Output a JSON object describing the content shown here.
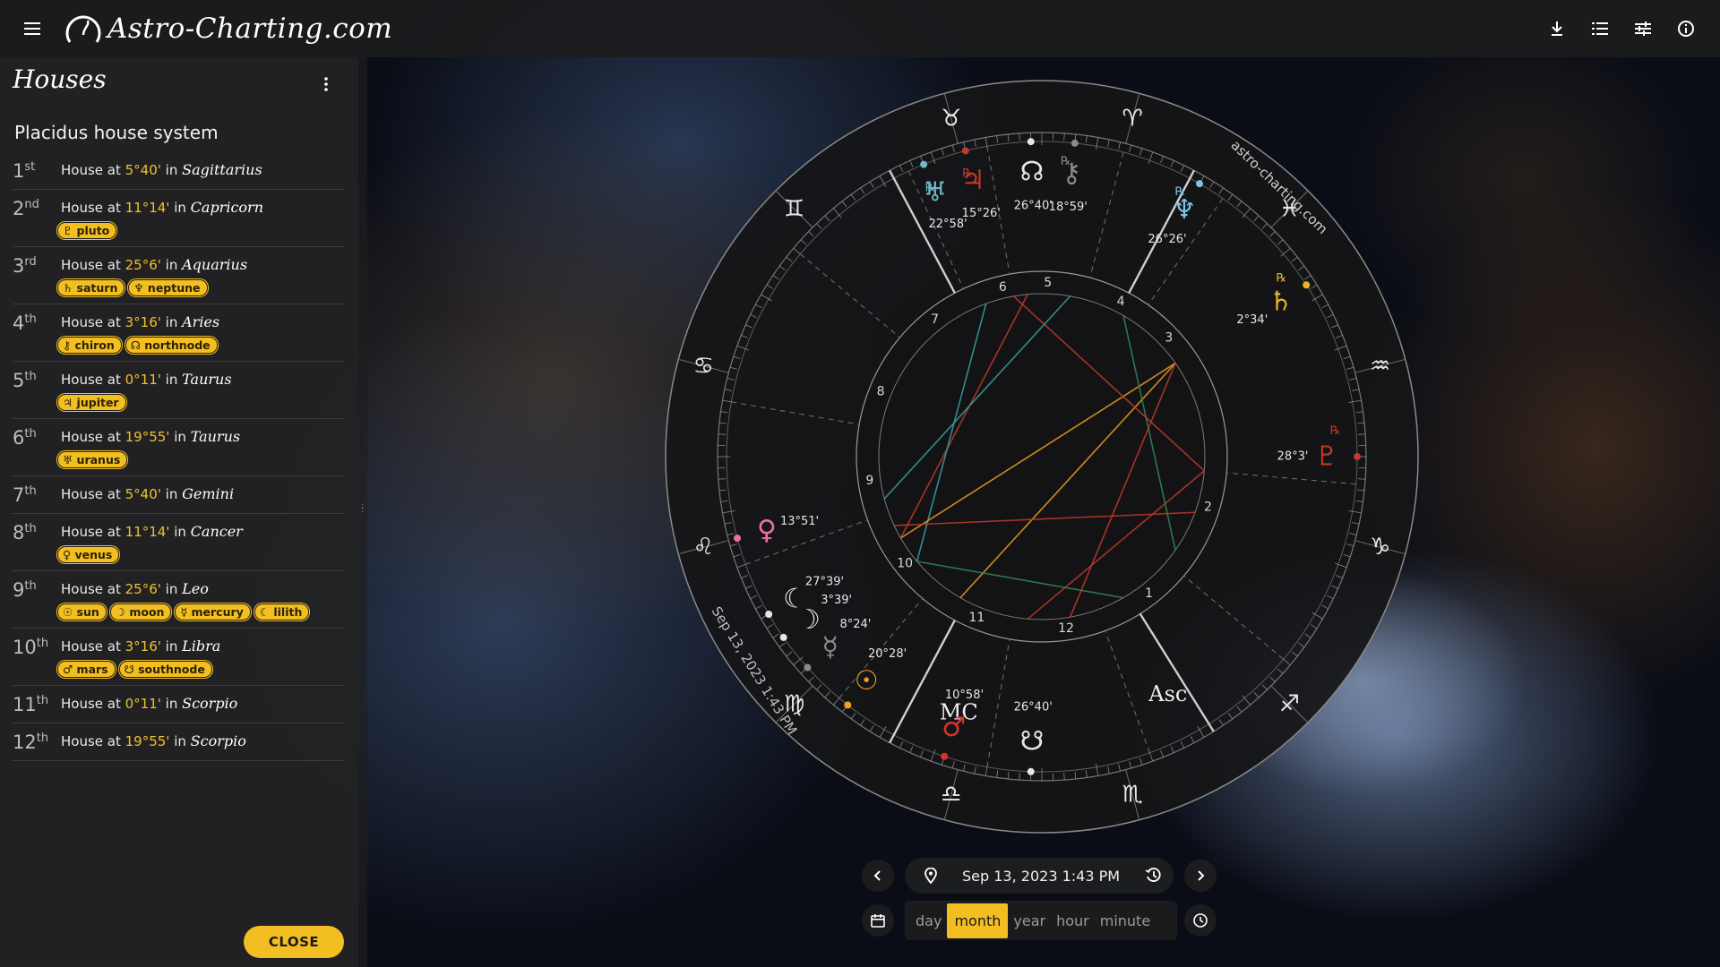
{
  "app": {
    "brand": "Astro-Charting.com",
    "accent_color": "#f2be22"
  },
  "toolbar": {
    "icons": [
      "download-icon",
      "list-icon",
      "tune-icon",
      "info-icon"
    ]
  },
  "panel": {
    "title": "Houses",
    "system": "Placidus house system",
    "house_prefix": "House at",
    "in_word": "in",
    "houses": [
      {
        "num": "1",
        "suffix": "st",
        "degree": "5°40'",
        "sign": "Sagittarius",
        "tags": []
      },
      {
        "num": "2",
        "suffix": "nd",
        "degree": "11°14'",
        "sign": "Capricorn",
        "tags": [
          {
            "glyph": "♇",
            "label": "pluto"
          }
        ]
      },
      {
        "num": "3",
        "suffix": "rd",
        "degree": "25°6'",
        "sign": "Aquarius",
        "tags": [
          {
            "glyph": "♄",
            "label": "saturn"
          },
          {
            "glyph": "♆",
            "label": "neptune"
          }
        ]
      },
      {
        "num": "4",
        "suffix": "th",
        "degree": "3°16'",
        "sign": "Aries",
        "tags": [
          {
            "glyph": "⚷",
            "label": "chiron"
          },
          {
            "glyph": "☊",
            "label": "northnode"
          }
        ]
      },
      {
        "num": "5",
        "suffix": "th",
        "degree": "0°11'",
        "sign": "Taurus",
        "tags": [
          {
            "glyph": "♃",
            "label": "jupiter"
          }
        ]
      },
      {
        "num": "6",
        "suffix": "th",
        "degree": "19°55'",
        "sign": "Taurus",
        "tags": [
          {
            "glyph": "♅",
            "label": "uranus"
          }
        ]
      },
      {
        "num": "7",
        "suffix": "th",
        "degree": "5°40'",
        "sign": "Gemini",
        "tags": []
      },
      {
        "num": "8",
        "suffix": "th",
        "degree": "11°14'",
        "sign": "Cancer",
        "tags": [
          {
            "glyph": "♀",
            "label": "venus"
          }
        ]
      },
      {
        "num": "9",
        "suffix": "th",
        "degree": "25°6'",
        "sign": "Leo",
        "tags": [
          {
            "glyph": "☉",
            "label": "sun"
          },
          {
            "glyph": "☽",
            "label": "moon"
          },
          {
            "glyph": "☿",
            "label": "mercury"
          },
          {
            "glyph": "☾",
            "label": "lilith"
          }
        ]
      },
      {
        "num": "10",
        "suffix": "th",
        "degree": "3°16'",
        "sign": "Libra",
        "tags": [
          {
            "glyph": "♂",
            "label": "mars"
          },
          {
            "glyph": "☋",
            "label": "southnode"
          }
        ]
      },
      {
        "num": "11",
        "suffix": "th",
        "degree": "0°11'",
        "sign": "Scorpio",
        "tags": []
      },
      {
        "num": "12",
        "suffix": "th",
        "degree": "19°55'",
        "sign": "Scorpio",
        "tags": []
      }
    ],
    "close_label": "CLOSE"
  },
  "chart": {
    "watermark": "astro-charting.com",
    "date_watermark": "Sep 13, 2023 1:43 PM",
    "zodiac_glyphs": [
      "♉",
      "♈",
      "♓",
      "♒",
      "♑",
      "♐",
      "♏",
      "♎",
      "♍",
      "♌",
      "♋",
      "♊"
    ],
    "house_numbers": [
      "5",
      "4",
      "3",
      "2",
      "1",
      "12",
      "11",
      "10",
      "9",
      "8",
      "7",
      "6"
    ],
    "angle_labels": {
      "mc": "MC",
      "asc": "Asc"
    },
    "planets": [
      {
        "glyph": "♅",
        "label": "22°58'",
        "color": "#6fb7c9",
        "retro": true
      },
      {
        "glyph": "♃",
        "label": "15°26'",
        "color": "#c0392b",
        "retro": true
      },
      {
        "glyph": "☊",
        "label": "26°40'",
        "color": "#e6e6e6",
        "retro": false
      },
      {
        "glyph": "⚷",
        "label": "18°59'",
        "color": "#8a8a8a",
        "retro": true
      },
      {
        "glyph": "♆",
        "label": "26°26'",
        "color": "#7ec3e8",
        "retro": true
      },
      {
        "glyph": "♄",
        "label": "2°34'",
        "color": "#e9b526",
        "retro": true
      },
      {
        "glyph": "♇",
        "label": "28°3'",
        "color": "#c0392b",
        "retro": true
      },
      {
        "glyph": "♀",
        "label": "13°51'",
        "color": "#f06fa0",
        "retro": false
      },
      {
        "glyph": "☾",
        "label": "27°39'",
        "color": "#e6e6e6",
        "retro": false
      },
      {
        "glyph": "☽",
        "label": "3°39'",
        "color": "#e6e6e6",
        "retro": false
      },
      {
        "glyph": "☿",
        "label": "8°24'",
        "color": "#8a8a8a",
        "retro": false
      },
      {
        "glyph": "☉",
        "label": "20°28'",
        "color": "#f0a020",
        "retro": false
      },
      {
        "glyph": "♂",
        "label": "10°58'",
        "color": "#d9322a",
        "retro": false
      },
      {
        "glyph": "☋",
        "label": "26°40'",
        "color": "#e6e6e6",
        "retro": false
      }
    ]
  },
  "controls": {
    "datetime": "Sep 13, 2023   1:43 PM",
    "units": [
      "day",
      "month",
      "year",
      "hour",
      "minute"
    ],
    "active_unit": "month"
  }
}
